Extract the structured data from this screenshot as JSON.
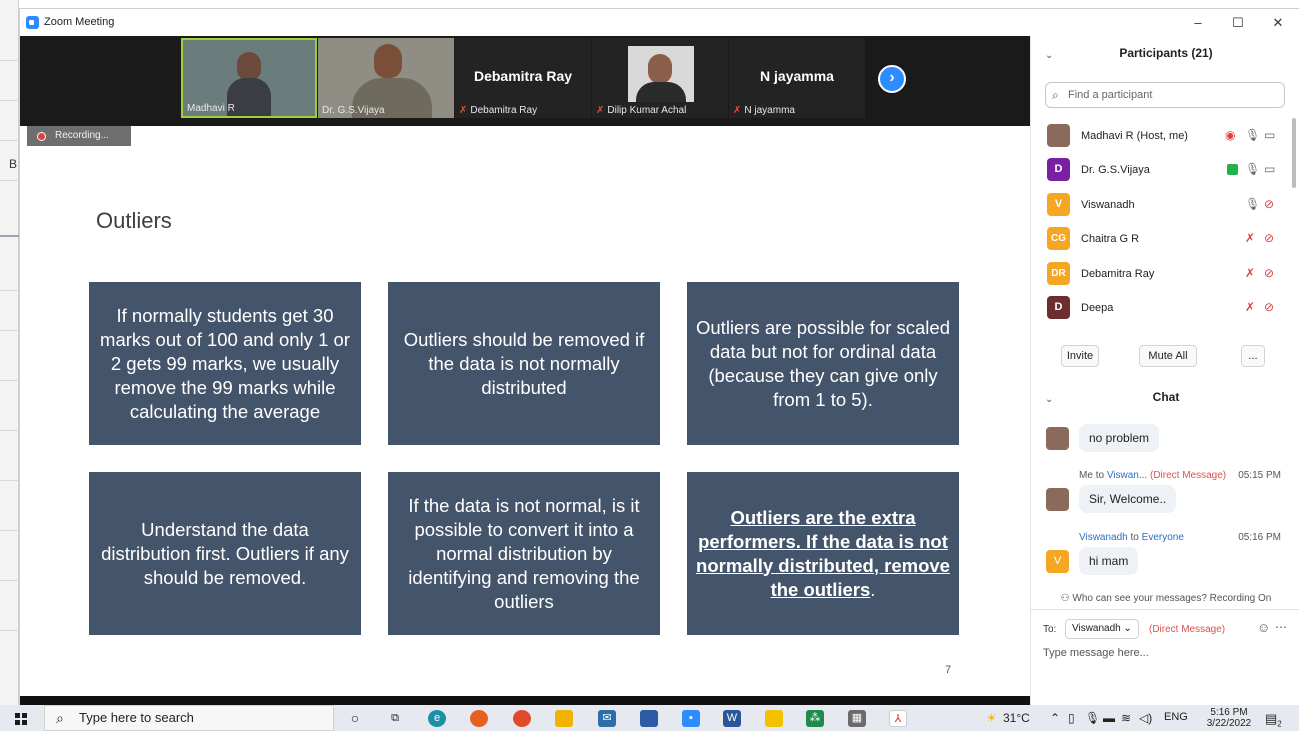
{
  "window": {
    "title": "Zoom Meeting",
    "minimize_glyph": "–",
    "maximize_glyph": "☐",
    "close_glyph": "✕"
  },
  "video_strip": {
    "tiles": [
      {
        "name": "Madhavi R",
        "type": "video",
        "active_speaker": true
      },
      {
        "name": "Dr. G.S.Vijaya",
        "type": "video"
      },
      {
        "name": "Debamitra Ray",
        "big_name": "Debamitra Ray",
        "type": "name",
        "muted": true
      },
      {
        "name": "Dilip Kumar Achal",
        "type": "photo",
        "muted": true
      },
      {
        "name": "N jayamma",
        "big_name": "N jayamma",
        "type": "name",
        "muted": true
      }
    ],
    "next_icon": "chevron-right-icon"
  },
  "recording": {
    "label": "Recording..."
  },
  "under_window": {
    "letter": "B"
  },
  "slide": {
    "title": "Outliers",
    "page_number": "7",
    "boxes": [
      {
        "text": "If normally students get 30 marks out of 100 and only 1 or 2 gets 99 marks, we usually remove the 99 marks while calculating the average"
      },
      {
        "text": "Outliers should be removed if the data is not normally distributed"
      },
      {
        "text": "Outliers are possible for scaled data but not for ordinal data (because they can give only from 1 to 5)."
      },
      {
        "text": "Understand the data distribution first.  Outliers if any should be removed."
      },
      {
        "text": "If the data is not normal, is it possible to convert it into a normal distribution by identifying and removing the outliers"
      },
      {
        "text": "Outliers are the extra performers.  If the data is not normally distributed, remove the outliers",
        "suffix": "."
      }
    ],
    "box_color": "#44546a"
  },
  "participants": {
    "header": "Participants (21)",
    "search_placeholder": "Find a participant",
    "list": [
      {
        "initials": "",
        "name": "Madhavi R (Host, me)",
        "color": "#8a6a5a",
        "photo": true
      },
      {
        "initials": "D",
        "name": "Dr. G.S.Vijaya",
        "color": "#7b1fa2"
      },
      {
        "initials": "V",
        "name": "Viswanadh",
        "color": "#f5a623"
      },
      {
        "initials": "CG",
        "name": "Chaitra G R",
        "color": "#f5a623"
      },
      {
        "initials": "DR",
        "name": "Debamitra Ray",
        "color": "#f5a623"
      },
      {
        "initials": "D",
        "name": "Deepa",
        "color": "#6b2d2d"
      }
    ],
    "buttons": {
      "invite": "Invite",
      "mute_all": "Mute All",
      "more": "..."
    }
  },
  "chat": {
    "header": "Chat",
    "messages": [
      {
        "text": "no problem"
      },
      {
        "sender": "Me",
        "to_word": "to",
        "recipient": "Viswan...",
        "dm": "(Direct Message)",
        "time": "05:15 PM",
        "text": "Sir, Welcome.."
      },
      {
        "sender": "Viswanadh",
        "to_word": "to",
        "recipient": "Everyone",
        "time": "05:16 PM",
        "text": "hi mam",
        "avatar_initial": "V"
      }
    ],
    "visibility_note": "Who can see your messages? Recording On",
    "to_label": "To:",
    "to_value": "Viswanadh",
    "to_dm": "(Direct Message)",
    "placeholder": "Type message here..."
  },
  "taskbar": {
    "search_placeholder": "Type here to search",
    "weather": "31°C",
    "language": "ENG",
    "time": "5:16 PM",
    "date": "3/22/2022",
    "notifications": "2"
  }
}
